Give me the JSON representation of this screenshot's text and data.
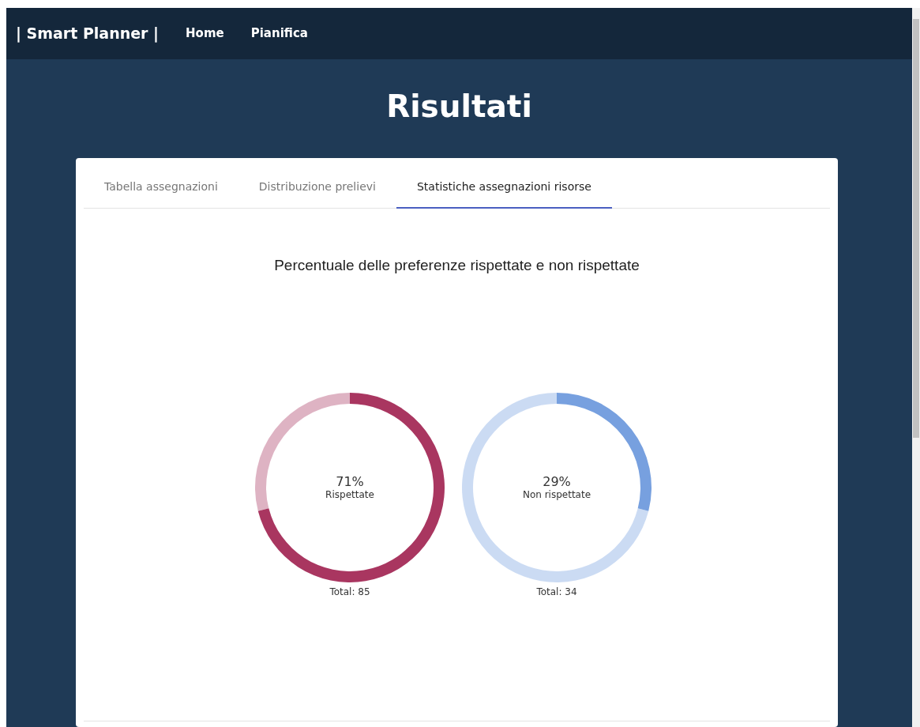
{
  "navbar": {
    "brand": "| Smart Planner |",
    "links": [
      "Home",
      "Pianifica"
    ]
  },
  "page_title": "Risultati",
  "tabs": [
    {
      "label": "Tabella assegnazioni",
      "selected": false
    },
    {
      "label": "Distribuzione prelievi",
      "selected": false
    },
    {
      "label": "Statistiche assegnazioni risorse",
      "selected": true
    }
  ],
  "chart_title": "Percentuale delle preferenze rispettate e non rispettate",
  "gauges": [
    {
      "value": "71%",
      "label": "Rispettate",
      "total": "Total: 85",
      "chart_data": {
        "type": "donut",
        "series": [
          {
            "color": "#a93660",
            "values": [
              71,
              29
            ]
          }
        ]
      }
    },
    {
      "value": "29%",
      "label": "Non rispettate",
      "total": "Total: 34",
      "chart_data": {
        "type": "donut",
        "series": [
          {
            "color": "#77a0df",
            "values": [
              29,
              71
            ]
          }
        ]
      }
    }
  ]
}
